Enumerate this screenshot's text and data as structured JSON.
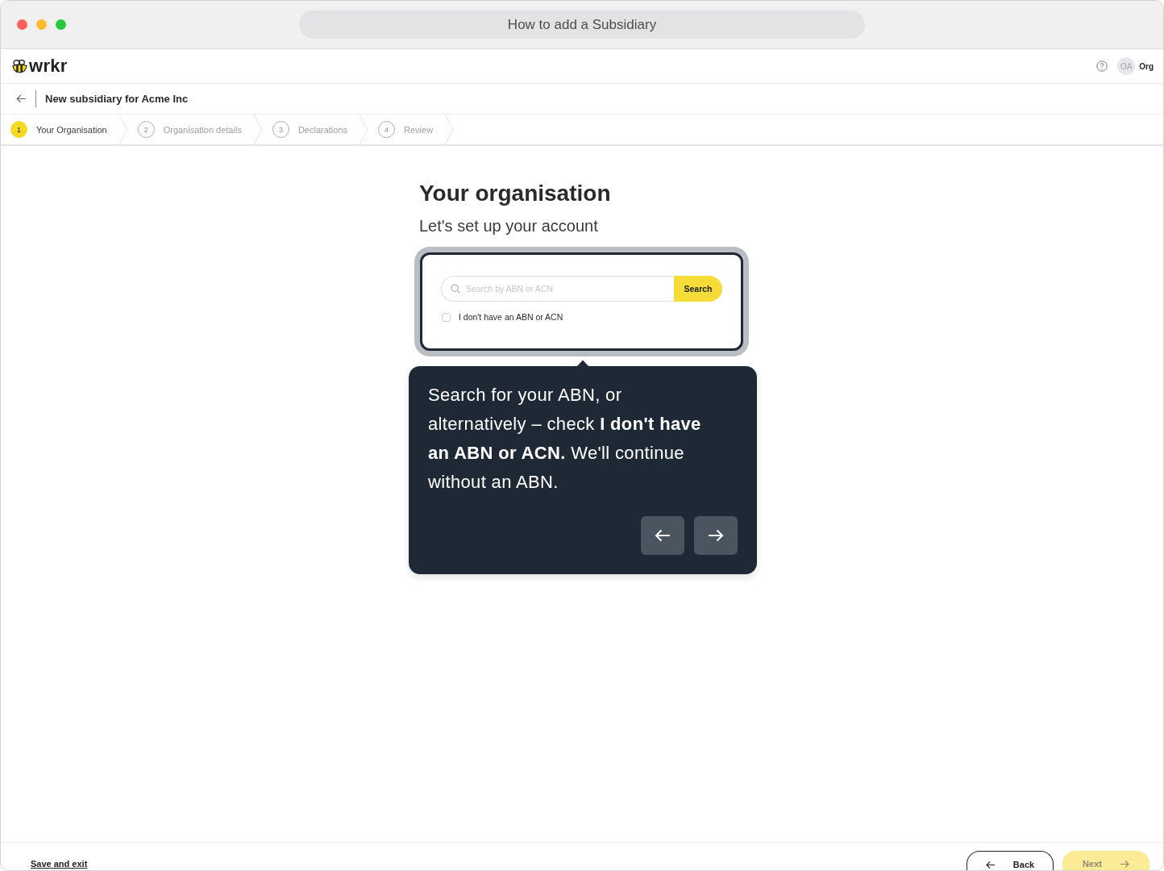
{
  "window": {
    "title": "How to add a Subsidiary"
  },
  "app_header": {
    "logo": "wrkr",
    "user": {
      "initials": "OA",
      "name": "Org"
    }
  },
  "page_header": {
    "title": "New subsidiary for Acme Inc"
  },
  "steps": [
    {
      "number": "1",
      "label": "Your Organisation",
      "selected": true
    },
    {
      "number": "2",
      "label": "Organisation details",
      "selected": false
    },
    {
      "number": "3",
      "label": "Declarations",
      "selected": false
    },
    {
      "number": "4",
      "label": "Review",
      "selected": false
    }
  ],
  "content": {
    "heading": "Your organisation",
    "subheading": "Let's set up your account"
  },
  "search": {
    "placeholder": "Search by ABN or ACN",
    "button": "Search"
  },
  "no_abn": {
    "label": "I don't have an ABN or ACN",
    "checked": false
  },
  "tooltip": {
    "text": "Search for your ABN, or alternatively – check **I don't have an ABN or ACN.** We'll continue without an ABN."
  },
  "footer": {
    "save_exit": "Save and exit",
    "back": "Back",
    "next": {
      "label": "Next",
      "disabled": true
    }
  }
}
